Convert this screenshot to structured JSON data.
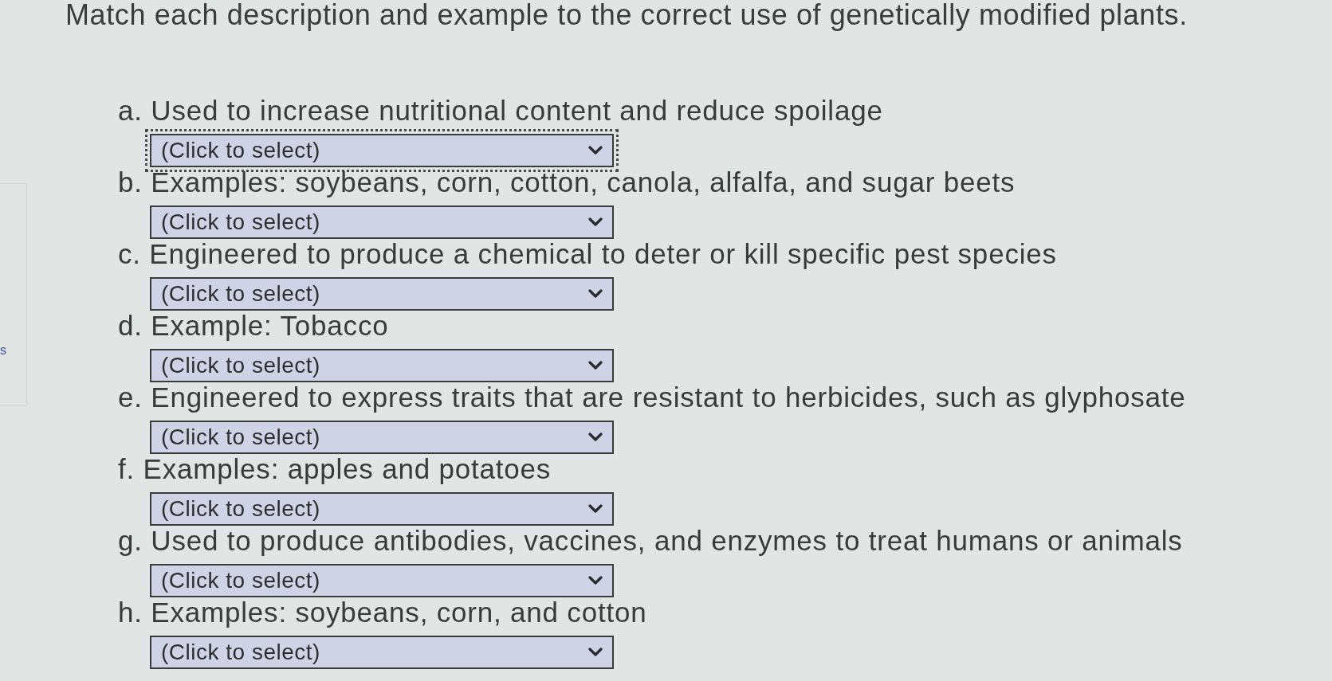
{
  "title": "Match each description and example to the correct use of genetically modified plants.",
  "left_edge_text": "s",
  "items": [
    {
      "text": "a. Used to increase nutritional content and reduce spoilage",
      "dropdown": {
        "value": "(Click to select)",
        "focused": true
      }
    },
    {
      "text": "b. Examples: soybeans, corn, cotton, canola, alfalfa, and sugar beets",
      "dropdown": {
        "value": "(Click to select)",
        "focused": false
      }
    },
    {
      "text": "c. Engineered to produce a chemical to deter or kill specific pest species",
      "dropdown": {
        "value": "(Click to select)",
        "focused": false
      }
    },
    {
      "text": "d. Example: Tobacco",
      "dropdown": {
        "value": "(Click to select)",
        "focused": false
      }
    },
    {
      "text": "e. Engineered to express traits that are resistant to herbicides, such as glyphosate",
      "dropdown": {
        "value": "(Click to select)",
        "focused": false
      }
    },
    {
      "text": "f. Examples: apples and potatoes",
      "dropdown": {
        "value": "(Click to select)",
        "focused": false
      }
    },
    {
      "text": "g. Used to produce antibodies, vaccines, and enzymes to treat humans or animals",
      "dropdown": {
        "value": "(Click to select)",
        "focused": false
      }
    },
    {
      "text": "h. Examples: soybeans, corn, and cotton",
      "dropdown": {
        "value": "(Click to select)",
        "focused": false
      }
    }
  ]
}
